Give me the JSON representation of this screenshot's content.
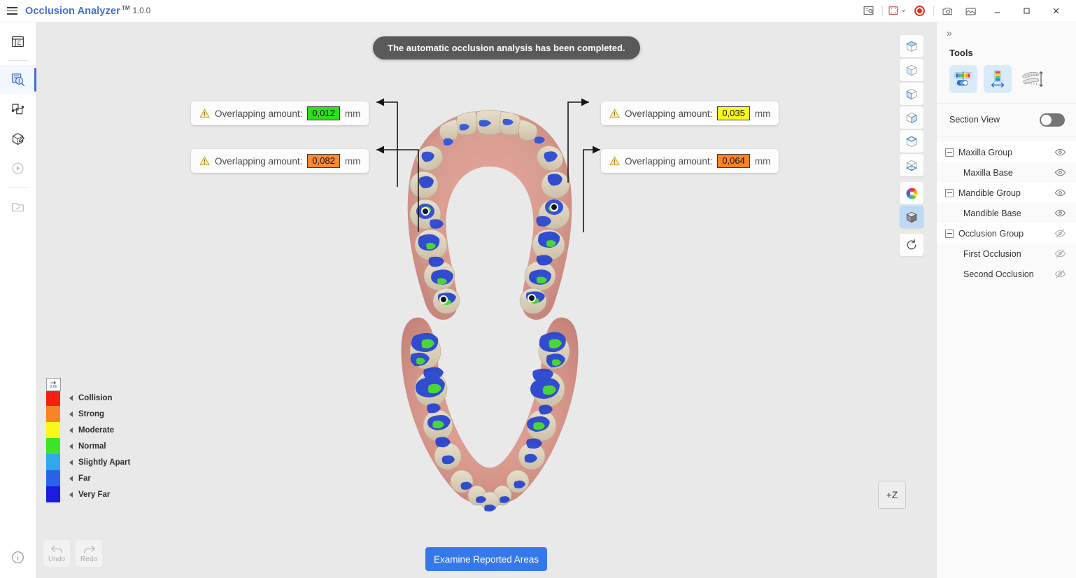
{
  "titlebar": {
    "app_name": "Occlusion Analyzer",
    "trademark": "TM",
    "version": "1.0.0",
    "icons": [
      {
        "name": "screenshot-annotate-icon",
        "glyph": "snapshot"
      },
      {
        "name": "capture-region-icon",
        "glyph": "region"
      },
      {
        "name": "record-icon",
        "glyph": "record"
      },
      {
        "name": "camera-icon",
        "glyph": "camera"
      },
      {
        "name": "gallery-icon",
        "glyph": "gallery"
      }
    ],
    "window_controls": {
      "minimize": "—",
      "maximize": "❐",
      "close": "✕"
    }
  },
  "left_rail": {
    "items": [
      {
        "name": "sidebar-item-case-table",
        "icon": "table-icon",
        "selected": false,
        "disabled": false
      },
      {
        "name": "sidebar-item-occlusion-analysis",
        "icon": "magnifier-info-icon",
        "selected": true,
        "disabled": false
      },
      {
        "name": "sidebar-item-align",
        "icon": "overlap-shapes-icon",
        "selected": false,
        "disabled": false
      },
      {
        "name": "sidebar-item-model-edit",
        "icon": "box-edit-icon",
        "selected": false,
        "disabled": false
      },
      {
        "name": "sidebar-item-play",
        "icon": "play-icon",
        "selected": false,
        "disabled": true
      },
      {
        "name": "sidebar-item-saved-cases",
        "icon": "folder-check-icon",
        "selected": false,
        "disabled": true
      }
    ],
    "bottom_item": {
      "name": "sidebar-item-info",
      "icon": "info-icon"
    }
  },
  "viewport": {
    "toast": "The automatic occlusion analysis has been completed.",
    "callouts": [
      {
        "label": "Overlapping amount:",
        "value": "0,012",
        "unit": "mm",
        "color": "#2ee019",
        "severity": "Normal",
        "position": "top-left"
      },
      {
        "label": "Overlapping amount:",
        "value": "0,082",
        "unit": "mm",
        "color": "#f98a36",
        "severity": "Strong",
        "position": "bottom-left"
      },
      {
        "label": "Overlapping amount:",
        "value": "0,035",
        "unit": "mm",
        "color": "#fbf81b",
        "severity": "Moderate",
        "position": "top-right"
      },
      {
        "label": "Overlapping amount:",
        "value": "0,064",
        "unit": "mm",
        "color": "#f98424",
        "severity": "Strong",
        "position": "bottom-right"
      }
    ],
    "legend": {
      "handle_value": "0.00",
      "items": [
        {
          "label": "Collision",
          "color": "#f81f0f"
        },
        {
          "label": "Strong",
          "color": "#f98424"
        },
        {
          "label": "Moderate",
          "color": "#fbf81b"
        },
        {
          "label": "Normal",
          "color": "#3ee22a"
        },
        {
          "label": "Slightly Apart",
          "color": "#2fa8ee"
        },
        {
          "label": "Far",
          "color": "#2a63ea"
        },
        {
          "label": "Very Far",
          "color": "#1b1be0"
        }
      ]
    },
    "undo_label": "Undo",
    "redo_label": "Redo",
    "primary_button": "Examine Reported Areas",
    "axis_gizmo": "+Z",
    "view_tools": [
      {
        "name": "view-front-icon",
        "active": false
      },
      {
        "name": "view-back-icon",
        "active": false
      },
      {
        "name": "view-left-icon",
        "active": false
      },
      {
        "name": "view-right-icon",
        "active": false
      },
      {
        "name": "view-top-icon",
        "active": false
      },
      {
        "name": "view-bottom-icon",
        "active": false
      },
      {
        "name": "color-wheel-icon",
        "active": false
      },
      {
        "name": "shaded-cube-icon",
        "active": true
      },
      {
        "name": "reset-view-icon",
        "active": false
      }
    ]
  },
  "right_panel": {
    "collapse_glyph": "»",
    "tools_title": "Tools",
    "tools": [
      {
        "name": "color-scale-toggle-tool",
        "active": true,
        "badge": "On"
      },
      {
        "name": "scale-range-tool",
        "active": true
      },
      {
        "name": "jaw-distance-tool",
        "active": false
      }
    ],
    "section_view": {
      "label": "Section View",
      "enabled": false
    },
    "tree": [
      {
        "label": "Maxilla Group",
        "type": "group",
        "visible": true
      },
      {
        "label": "Maxilla Base",
        "type": "child",
        "visible": true
      },
      {
        "label": "Mandible Group",
        "type": "group",
        "visible": true
      },
      {
        "label": "Mandible Base",
        "type": "child",
        "visible": true
      },
      {
        "label": "Occlusion Group",
        "type": "group",
        "visible": false
      },
      {
        "label": "First Occlusion",
        "type": "child",
        "visible": false
      },
      {
        "label": "Second Occlusion",
        "type": "child",
        "visible": false
      }
    ]
  }
}
